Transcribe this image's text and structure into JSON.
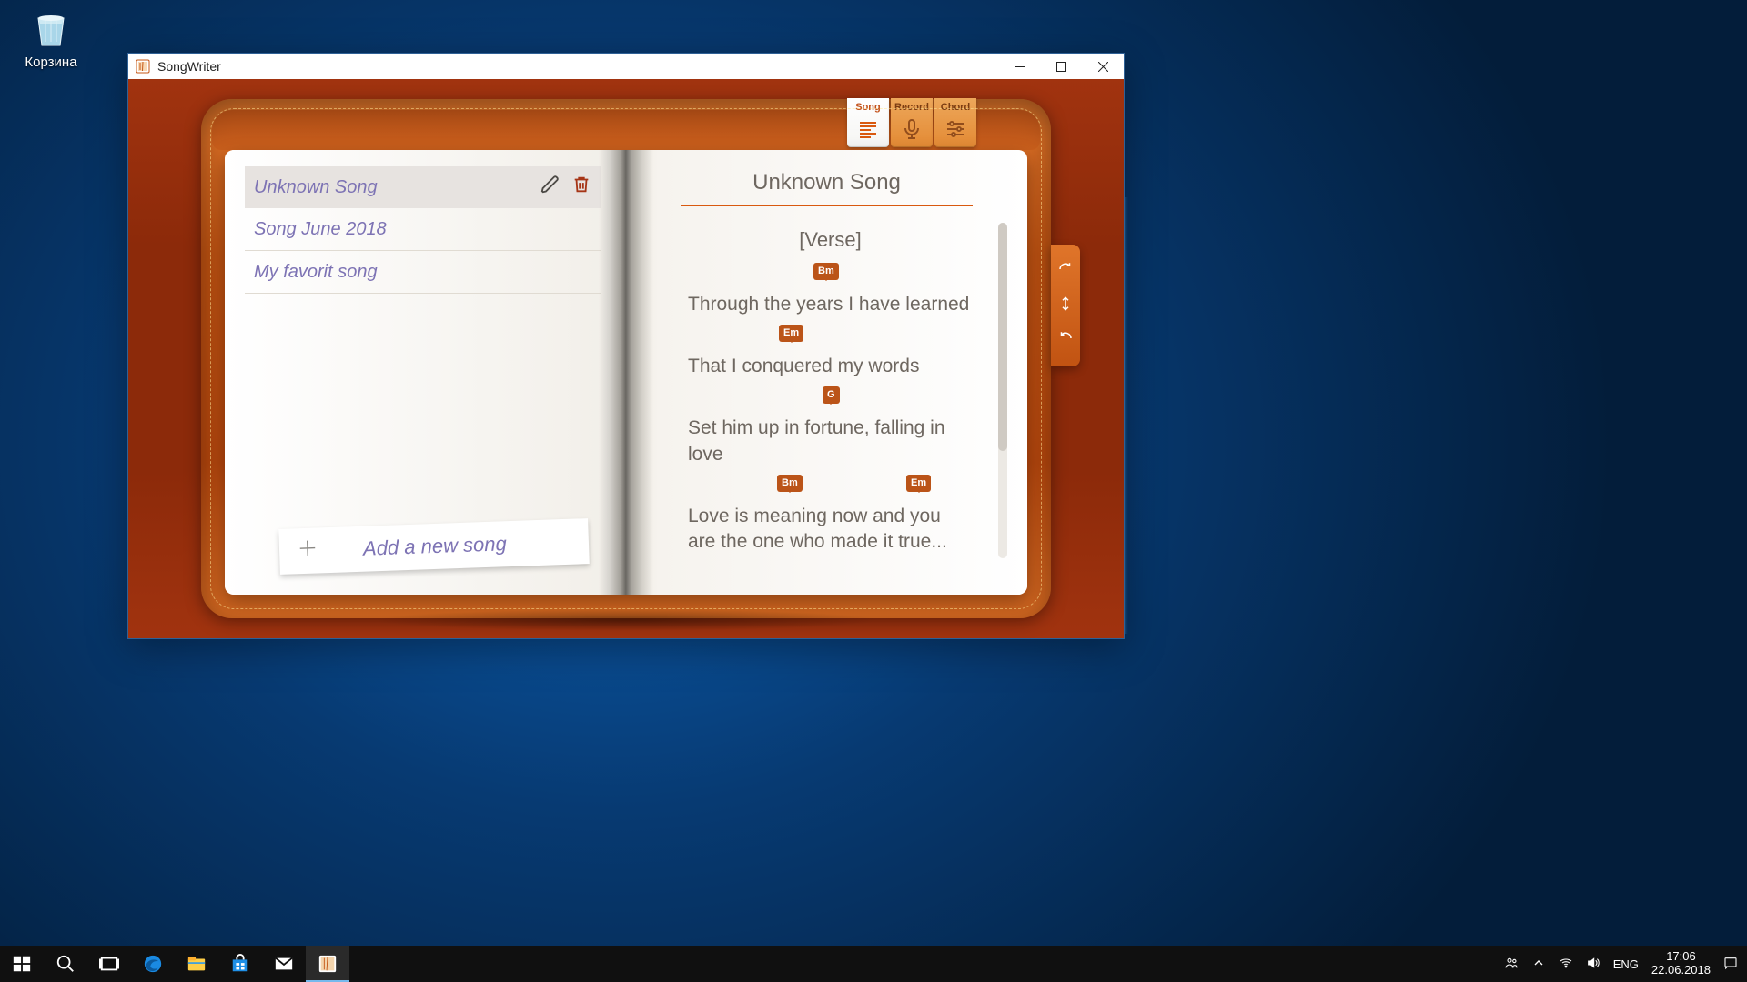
{
  "desktop": {
    "recycle_label": "Корзина"
  },
  "window": {
    "title": "SongWriter"
  },
  "tabs": [
    {
      "label": "Song",
      "icon": "text-lines"
    },
    {
      "label": "Record",
      "icon": "microphone"
    },
    {
      "label": "Chord",
      "icon": "sliders"
    }
  ],
  "songs": [
    {
      "title": "Unknown Song",
      "selected": true
    },
    {
      "title": "Song June 2018",
      "selected": false
    },
    {
      "title": "My favorit song",
      "selected": false
    }
  ],
  "add_label": "Add a new song",
  "current_song": {
    "title": "Unknown Song",
    "section": "[Verse]",
    "lines": [
      {
        "text": "Through the years I have learned",
        "chords": [
          {
            "name": "Bm",
            "pos": 138
          }
        ]
      },
      {
        "text": "That I conquered my words",
        "chords": [
          {
            "name": "Em",
            "pos": 100
          }
        ]
      },
      {
        "text": "Set him up in fortune, falling in love",
        "chords": [
          {
            "name": "G",
            "pos": 148
          }
        ]
      },
      {
        "text": "Love is meaning now and you are the one who made it true...",
        "chords": [
          {
            "name": "Bm",
            "pos": 98
          },
          {
            "name": "Em",
            "pos": 240
          }
        ]
      }
    ]
  },
  "taskbar": {
    "lang": "ENG",
    "time": "17:06",
    "date": "22.06.2018"
  }
}
